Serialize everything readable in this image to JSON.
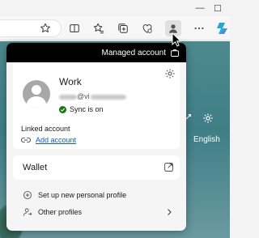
{
  "window": {
    "minimize_glyph": "—",
    "maximize_glyph": "☐"
  },
  "toolbar": {
    "icons": [
      "favorite-star-icon",
      "split-screen-icon",
      "favorites-icon",
      "collections-icon",
      "performance-icon",
      "profile-icon",
      "more-icon",
      "copilot-icon"
    ]
  },
  "flyout": {
    "managed_label": "Managed account",
    "profile": {
      "name": "Work",
      "email_visible": "@vi",
      "sync_status": "Sync is on"
    },
    "linked_account_label": "Linked account",
    "add_account_label": "Add account",
    "wallet_label": "Wallet",
    "setup_profile_label": "Set up new personal profile",
    "other_profiles_label": "Other profiles"
  },
  "background_page": {
    "language_label": "English"
  },
  "colors": {
    "managed_strip": "#000000",
    "sync_green": "#0f7b0f",
    "link_blue": "#0f5cbc",
    "page_teal": "#4c8a8e"
  }
}
